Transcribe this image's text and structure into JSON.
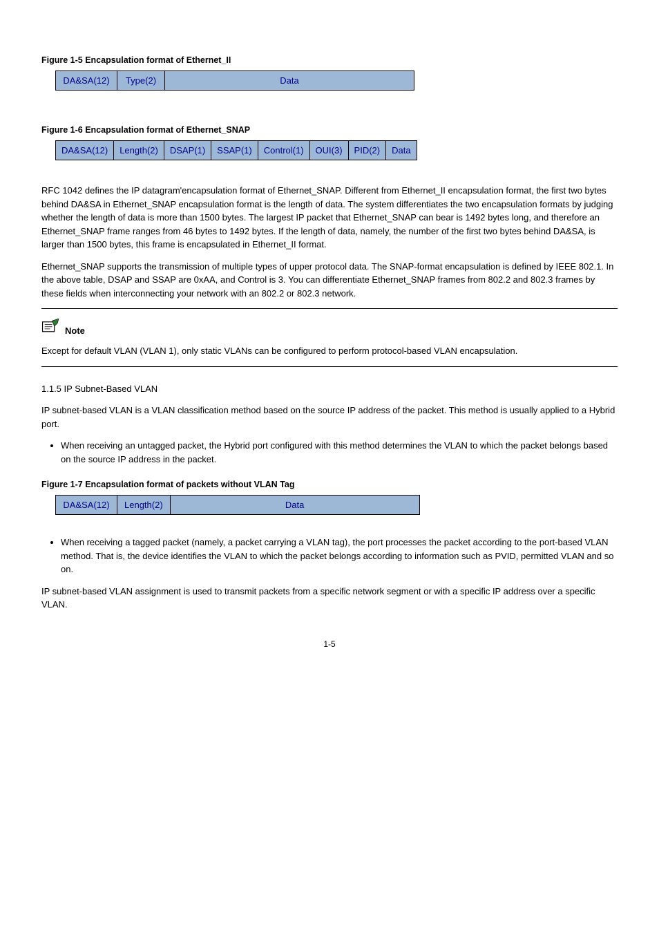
{
  "fig1": {
    "caption": "Figure 1-5 Encapsulation format of Ethernet_II",
    "cells": [
      "DA&SA(12)",
      "Type(2)",
      "Data"
    ]
  },
  "fig2": {
    "caption": "Figure 1-6 Encapsulation format of Ethernet_SNAP",
    "cells": [
      "DA&SA(12)",
      "Length(2)",
      "DSAP(1)",
      "SSAP(1)",
      "Control(1)",
      "OUI(3)",
      "PID(2)",
      "Data"
    ]
  },
  "para1": "RFC 1042 defines the IP datagram'encapsulation format of Ethernet_SNAP. Different from Ethernet_II encapsulation format, the first two bytes behind DA&SA in Ethernet_SNAP encapsulation format is the length of data. The system differentiates the two encapsulation formats by judging whether the length of data is more than 1500 bytes. The largest IP packet that Ethernet_SNAP can bear is 1492 bytes long, and therefore an Ethernet_SNAP frame ranges from 46 bytes to 1492 bytes. If the length of data, namely, the number of the first two bytes behind DA&SA, is larger than 1500 bytes, this frame is encapsulated in Ethernet_II format.",
  "para2": "Ethernet_SNAP supports the transmission of multiple types of upper protocol data. The SNAP-format encapsulation is defined by IEEE 802.1. In the above table, DSAP and SSAP are 0xAA, and Control is 3. You can differentiate Ethernet_SNAP frames from 802.2 and 802.3 frames by these fields when interconnecting your network with an 802.2 or 802.3 network.",
  "note": {
    "label": "Note",
    "text": "Except for default VLAN (VLAN 1), only static VLANs can be configured to perform protocol-based VLAN encapsulation."
  },
  "section": {
    "num": "1.1.5  ",
    "title": "IP Subnet-Based VLAN"
  },
  "para3": "IP subnet-based VLAN is a VLAN classification method based on the source IP address of the packet. This method is usually applied to a Hybrid port.",
  "bullets": [
    "When receiving an untagged packet, the Hybrid port configured with this method determines the VLAN to which the packet belongs based on the source IP address in the packet.",
    "When receiving a tagged packet (namely, a packet carrying a VLAN tag), the port processes the packet according to the port-based VLAN method. That is, the device identifies the VLAN to which the packet belongs according to information such as PVID, permitted VLAN and so on."
  ],
  "fig3": {
    "caption": "Figure 1-7 Encapsulation format of packets without VLAN Tag",
    "cells": [
      "DA&SA(12)",
      "Length(2)",
      "Data"
    ]
  },
  "para4": "IP subnet-based VLAN assignment is used to transmit packets from a specific network segment or with a specific IP address over a specific VLAN.",
  "footer": "1-5"
}
